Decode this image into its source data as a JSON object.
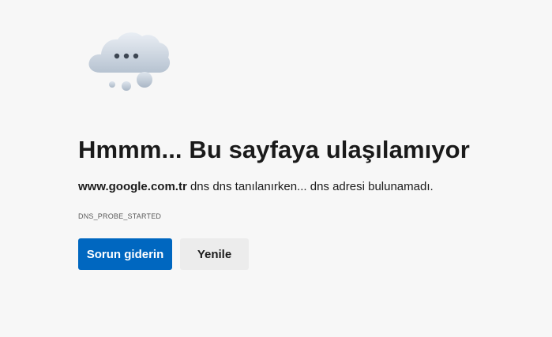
{
  "page": {
    "icon": "cloud-thinking-icon",
    "title": "Hmmm... Bu sayfaya ulaşılamıyor",
    "message": {
      "domain": "www.google.com.tr",
      "text": " dns dns tanılanırken... dns adresi bulunamadı."
    },
    "error_code": "DNS_PROBE_STARTED",
    "buttons": {
      "troubleshoot_label": "Sorun giderin",
      "refresh_label": "Yenile"
    }
  },
  "colors": {
    "background": "#f7f7f7",
    "primary": "#0067c0",
    "secondary": "#ececec"
  }
}
